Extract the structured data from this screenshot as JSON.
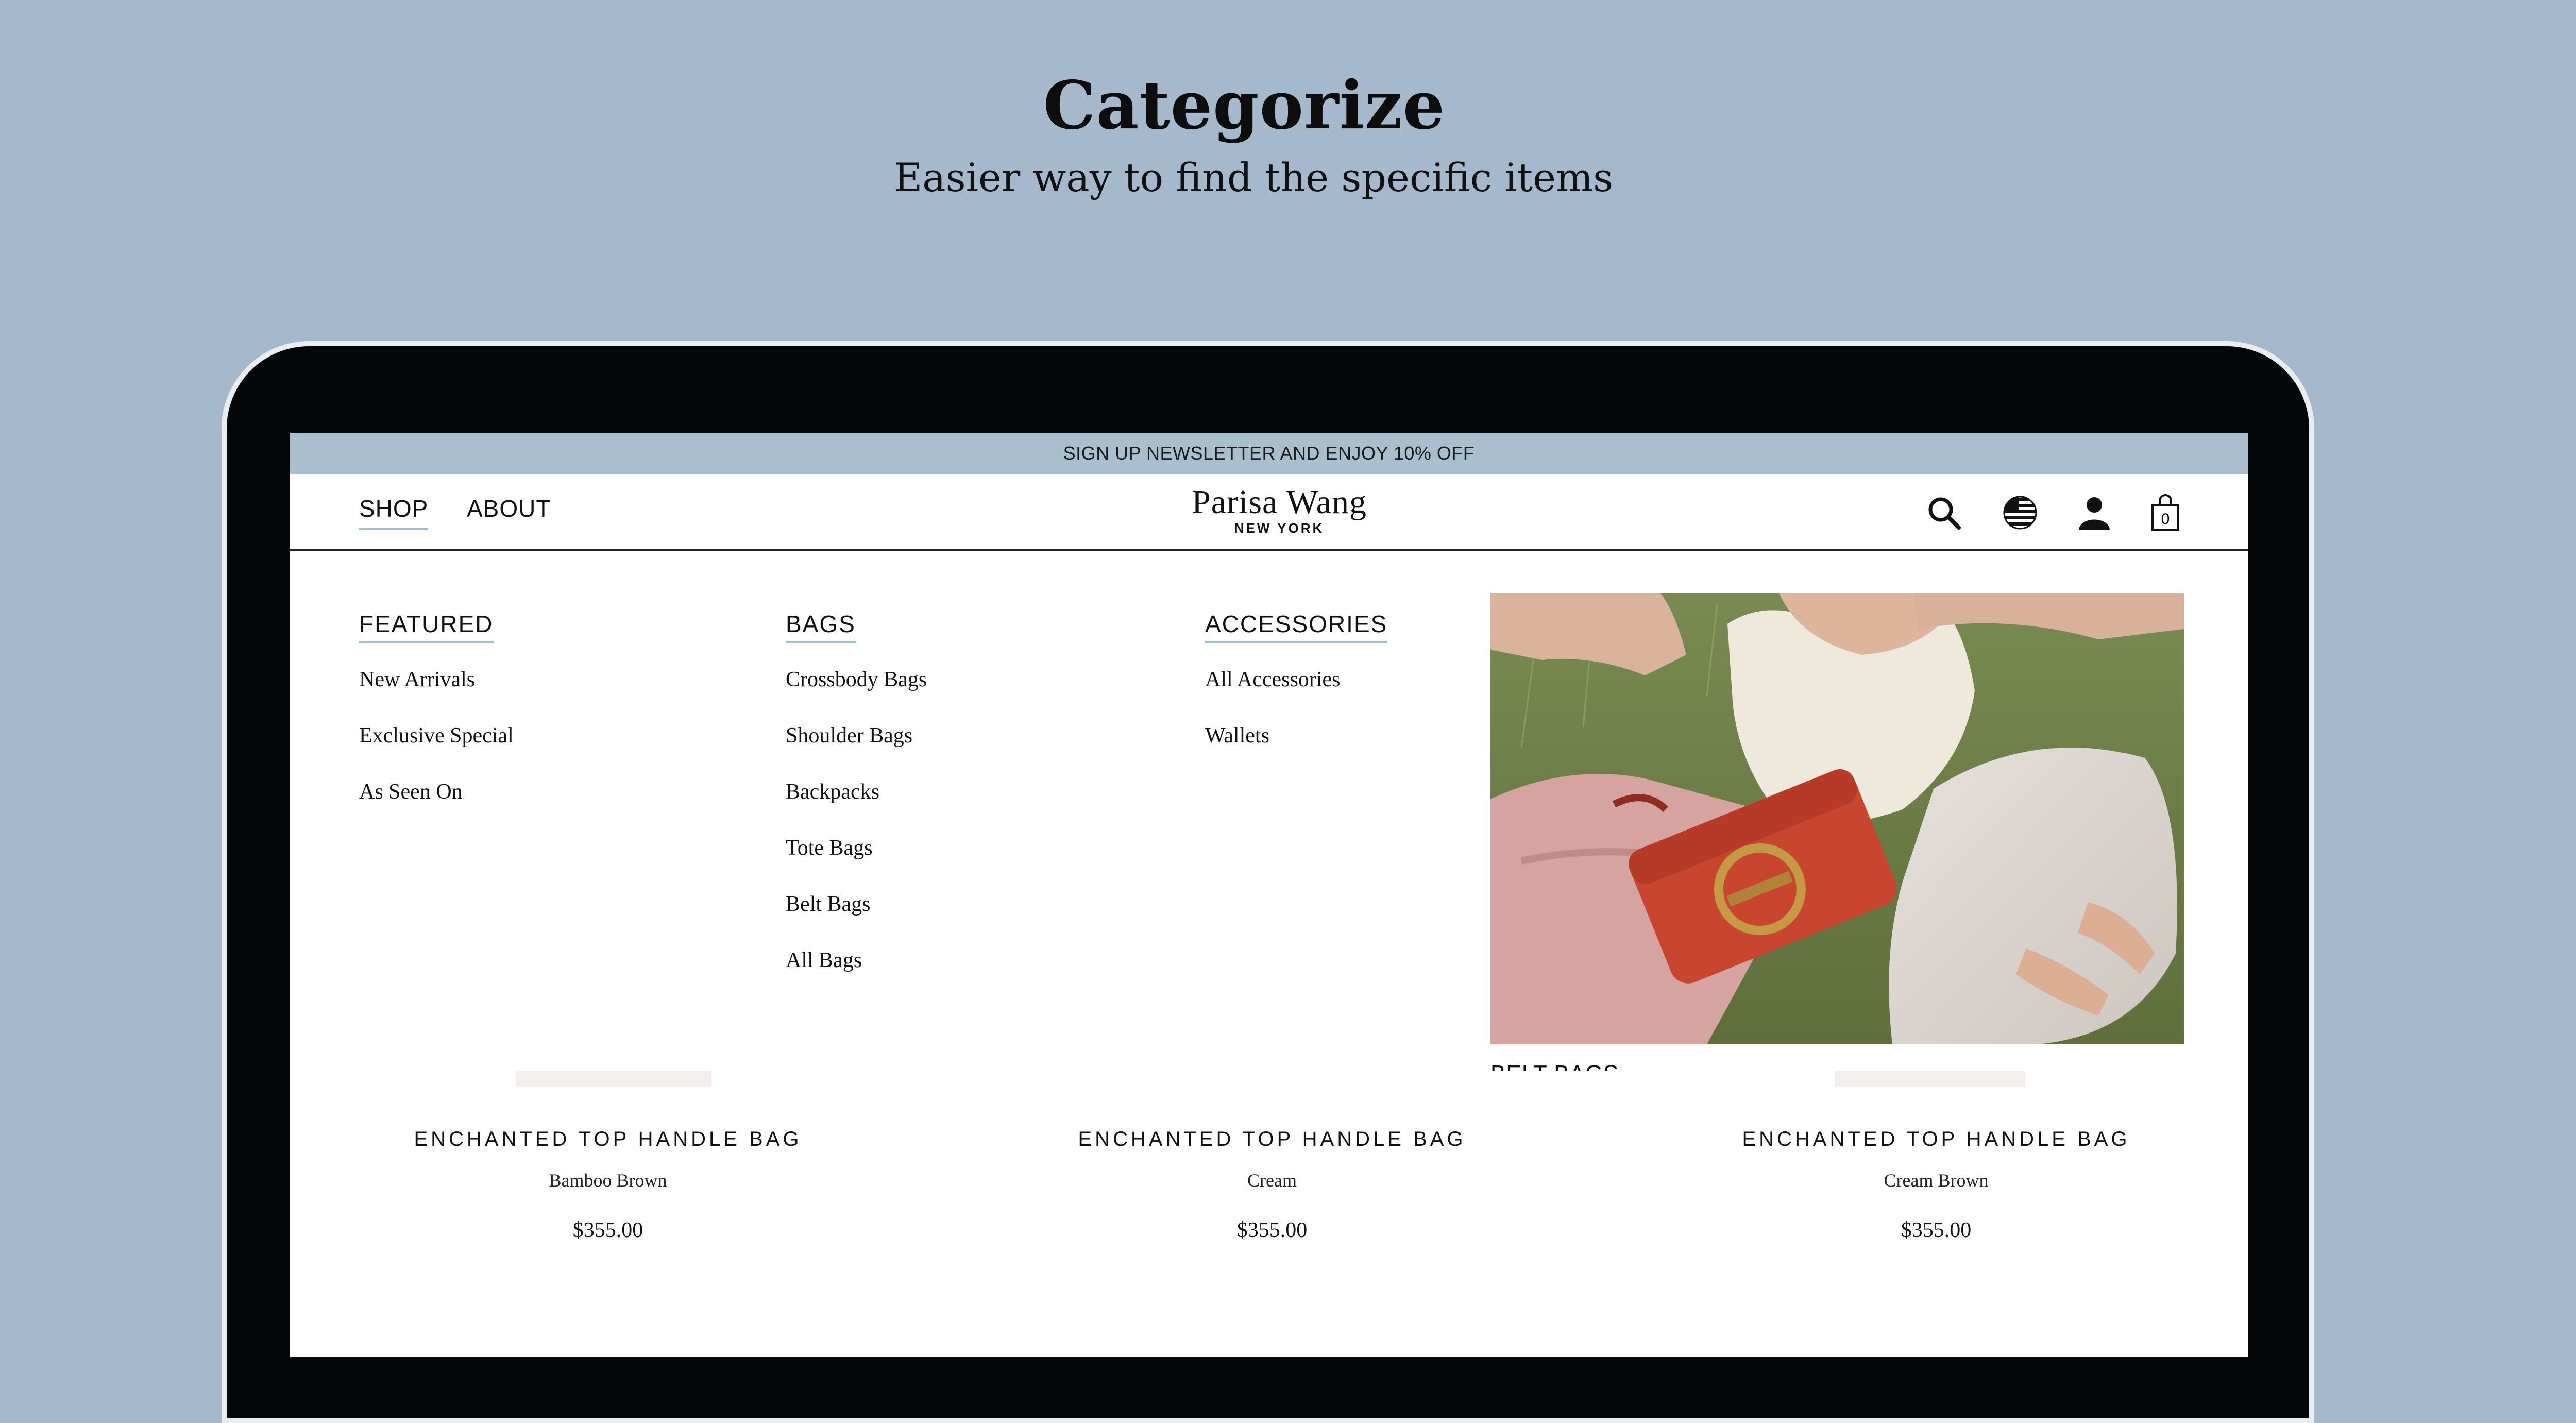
{
  "hero": {
    "title": "Categorize",
    "subtitle": "Easier way to find the specific items"
  },
  "promo_bar": {
    "text": "SIGN UP NEWSLETTER AND ENJOY 10% OFF"
  },
  "header": {
    "nav": [
      "SHOP",
      "ABOUT"
    ],
    "logo_name": "Parisa Wang",
    "logo_sub": "NEW YORK",
    "icons": [
      "search-icon",
      "flag-icon",
      "account-icon",
      "shopping-bag-icon"
    ],
    "cart_count": "0"
  },
  "mega_menu": {
    "columns": [
      {
        "heading": "FEATURED",
        "items": [
          "New Arrivals",
          "Exclusive Special",
          "As Seen On"
        ]
      },
      {
        "heading": "BAGS",
        "items": [
          "Crossbody Bags",
          "Shoulder Bags",
          "Backpacks",
          "Tote Bags",
          "Belt Bags",
          "All Bags"
        ]
      },
      {
        "heading": "ACCESSORIES",
        "items": [
          "All Accessories",
          "Wallets"
        ]
      }
    ],
    "promo_caption": "BELT BAGS"
  },
  "products": [
    {
      "title": "ENCHANTED TOP HANDLE BAG",
      "color": "Bamboo Brown",
      "price": "$355.00"
    },
    {
      "title": "ENCHANTED TOP HANDLE BAG",
      "color": "Cream",
      "price": "$355.00"
    },
    {
      "title": "ENCHANTED TOP HANDLE BAG",
      "color": "Cream Brown",
      "price": "$355.00"
    }
  ],
  "colors": {
    "background": "#a6b9cc",
    "accent": "#a9bfcd",
    "bag": "#c8452f"
  }
}
